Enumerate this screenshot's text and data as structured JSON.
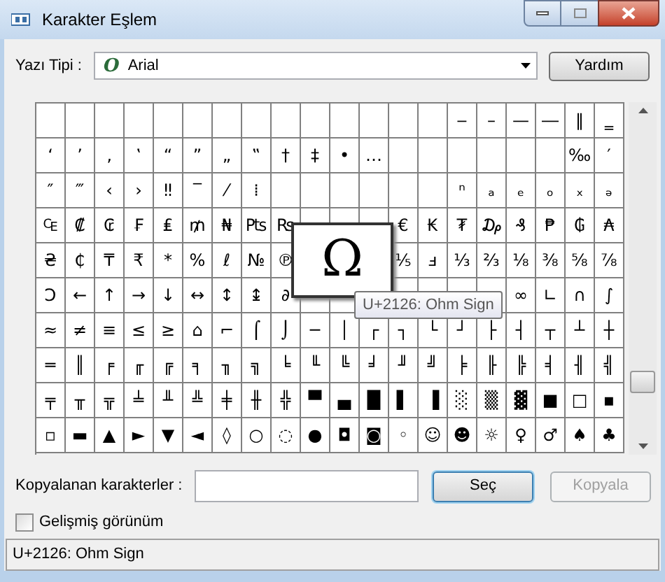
{
  "window": {
    "title": "Karakter Eşlem"
  },
  "font": {
    "label": "Yazı Tipi :",
    "icon": "O",
    "value": "Arial"
  },
  "help_button": "Yardım",
  "grid": {
    "rows": [
      [
        null,
        null,
        null,
        null,
        null,
        null,
        null,
        null,
        null,
        null,
        null,
        null,
        null,
        null,
        "‒",
        "–",
        "—",
        "―",
        "‖",
        "‗"
      ],
      [
        "‘",
        "’",
        "‚",
        "‛",
        "“",
        "”",
        "„",
        "‟",
        "†",
        "‡",
        "•",
        "…",
        null,
        null,
        null,
        null,
        null,
        null,
        "‰",
        "′"
      ],
      [
        "″",
        "‴",
        "‹",
        "›",
        "‼",
        "‾",
        "⁄",
        "⁞",
        null,
        null,
        null,
        null,
        null,
        null,
        "ⁿ",
        "ₐ",
        "ₑ",
        "ₒ",
        "ₓ",
        "ₔ"
      ],
      [
        "₠",
        "₡",
        "₢",
        "₣",
        "₤",
        "₥",
        "₦",
        "₧",
        "₨",
        null,
        null,
        null,
        "€",
        "₭",
        "₮",
        "₯",
        "₰",
        "₱",
        "₲",
        "₳"
      ],
      [
        "₴",
        "₵",
        "₸",
        "₹",
        "*",
        "%",
        "ℓ",
        "№",
        "℗",
        null,
        null,
        null,
        "⅕",
        "ⅎ",
        "⅓",
        "⅔",
        "⅛",
        "⅜",
        "⅝",
        "⅞"
      ],
      [
        "Ↄ",
        "←",
        "↑",
        "→",
        "↓",
        "↔",
        "↕",
        "↨",
        "∂",
        null,
        null,
        null,
        null,
        null,
        null,
        null,
        "∞",
        "∟",
        "∩",
        "∫"
      ],
      [
        "≈",
        "≠",
        "≡",
        "≤",
        "≥",
        "⌂",
        "⌐",
        "⌠",
        "⌡",
        "─",
        "│",
        "┌",
        "┐",
        "└",
        "┘",
        "├",
        "┤",
        "┬",
        "┴",
        "┼"
      ],
      [
        "═",
        "║",
        "╒",
        "╓",
        "╔",
        "╕",
        "╖",
        "╗",
        "╘",
        "╙",
        "╚",
        "╛",
        "╜",
        "╝",
        "╞",
        "╟",
        "╠",
        "╡",
        "╢",
        "╣"
      ],
      [
        "╤",
        "╥",
        "╦",
        "╧",
        "╨",
        "╩",
        "╪",
        "╫",
        "╬",
        "▀",
        "▄",
        "█",
        "▌",
        "▐",
        "░",
        "▒",
        "▓",
        "■",
        "□",
        "▪"
      ],
      [
        "▫",
        "▬",
        "▲",
        "►",
        "▼",
        "◄",
        "◊",
        "○",
        "◌",
        "●",
        "◘",
        "◙",
        "◦",
        "☺",
        "☻",
        "☼",
        "♀",
        "♂",
        "♠",
        "♣"
      ]
    ]
  },
  "preview": {
    "glyph": "Ω"
  },
  "tooltip": "U+2126: Ohm Sign",
  "copy": {
    "label": "Kopyalanan karakterler :"
  },
  "select_button": {
    "label": "Seç",
    "focused": true
  },
  "copy_button": {
    "label": "Kopyala",
    "disabled": true
  },
  "advanced": {
    "label": "Gelişmiş görünüm",
    "checked": false
  },
  "status_bar": "U+2126: Ohm Sign"
}
